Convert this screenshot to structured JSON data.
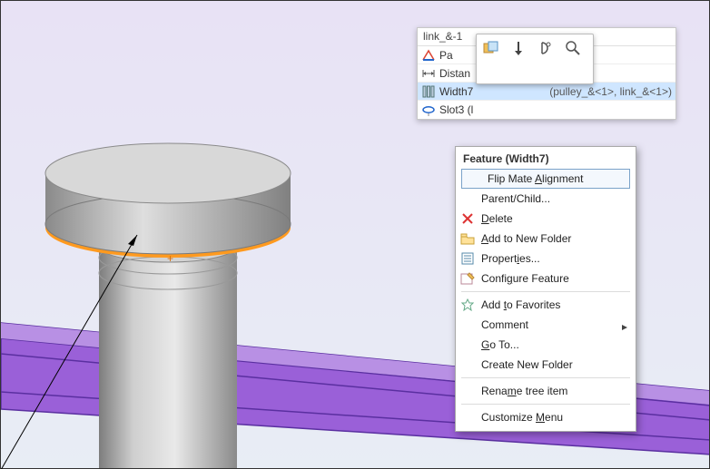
{
  "crumb": {
    "title": "link_&-1",
    "rows": [
      {
        "icon": "mate-coincident-icon",
        "label": "Pa",
        "extra": ""
      },
      {
        "icon": "mate-distance-icon",
        "label": "Distan",
        "extra": ""
      },
      {
        "icon": "mate-width-icon",
        "label": "Width7",
        "extra": "(pulley_&<1>, link_&<1>)"
      },
      {
        "icon": "mate-slot-icon",
        "label": "Slot3 (l",
        "extra": ""
      }
    ],
    "selectedIndex": 2
  },
  "contextToolbar": {
    "buttons": [
      "edit-feature-icon",
      "suppress-icon",
      "isolate-icon",
      "zoom-to-icon"
    ]
  },
  "contextMenu": {
    "header": "Feature (Width7)",
    "items": [
      {
        "icon": "",
        "label_html": "Flip Mate <u>A</u>lignment",
        "highlight": true
      },
      {
        "icon": "",
        "label_html": "Parent/Child..."
      },
      {
        "icon": "delete-icon",
        "label_html": "<u>D</u>elete"
      },
      {
        "icon": "folder-icon",
        "label_html": "<u>A</u>dd to New Folder"
      },
      {
        "icon": "properties-icon",
        "label_html": "Propert<u>i</u>es..."
      },
      {
        "icon": "configure-icon",
        "label_html": "Confi<u>g</u>ure Feature"
      },
      {
        "sep": true
      },
      {
        "icon": "favorite-icon",
        "label_html": "Add <u>t</u>o Favorites"
      },
      {
        "icon": "",
        "label_html": "Comment",
        "submenu": true
      },
      {
        "icon": "",
        "label_html": "<u>G</u>o To..."
      },
      {
        "icon": "",
        "label_html": "Create New Folder"
      },
      {
        "sep": true
      },
      {
        "icon": "",
        "label_html": "Rena<u>m</u>e tree item"
      },
      {
        "sep": true
      },
      {
        "icon": "",
        "label_html": "Customize <u>M</u>enu"
      }
    ]
  }
}
